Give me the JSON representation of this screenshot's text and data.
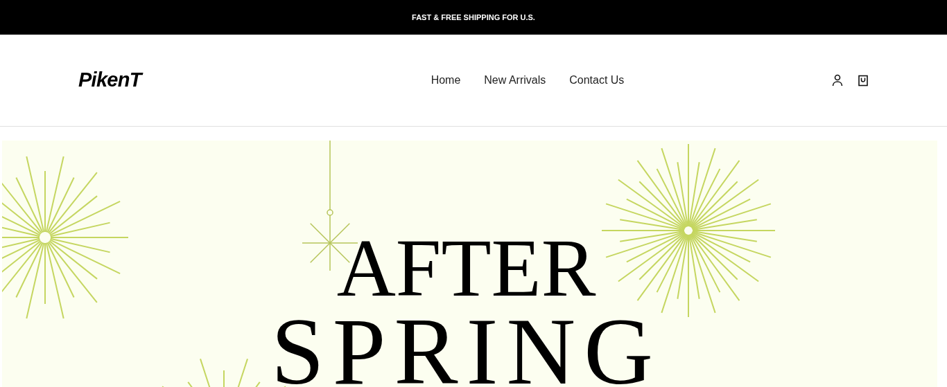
{
  "announcement": "FAST & FREE SHIPPING FOR U.S.",
  "header": {
    "logo": "PikenT",
    "nav": [
      {
        "label": "Home"
      },
      {
        "label": "New Arrivals"
      },
      {
        "label": "Contact Us"
      }
    ]
  },
  "hero": {
    "line_1": "AFTER",
    "line_2": "SPRING"
  }
}
